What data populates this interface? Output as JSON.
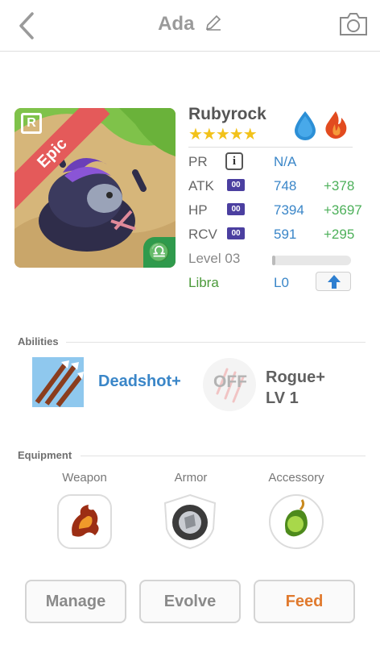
{
  "header": {
    "title": "Ada"
  },
  "card": {
    "rarity_badge": "R",
    "rarity": "Epic",
    "sign_glyph": "♎"
  },
  "monster": {
    "name": "Rubyrock",
    "stars": "★★★★★",
    "elements": [
      "water-drop-icon",
      "fire-icon"
    ],
    "colors": {
      "water": "#2c8fd6",
      "fire": "#e24b1f",
      "star": "#f2c21a"
    }
  },
  "stats": {
    "pr": {
      "label": "PR",
      "value": "N/A"
    },
    "atk": {
      "label": "ATK",
      "badge": "00",
      "value": "748",
      "bonus": "+378"
    },
    "hp": {
      "label": "HP",
      "badge": "00",
      "value": "7394",
      "bonus": "+3697"
    },
    "rcv": {
      "label": "RCV",
      "badge": "00",
      "value": "591",
      "bonus": "+295"
    },
    "level": {
      "label": "Level 03",
      "progress": 0.04
    },
    "sign": {
      "label": "Libra",
      "value": "L0"
    }
  },
  "abilities": {
    "title": "Abilities",
    "primary": {
      "name": "Deadshot+"
    },
    "secondary": {
      "state": "OFF",
      "name": "Rogue+",
      "level": "LV 1"
    }
  },
  "equipment": {
    "title": "Equipment",
    "slots": [
      {
        "label": "Weapon"
      },
      {
        "label": "Armor"
      },
      {
        "label": "Accessory"
      }
    ]
  },
  "buttons": {
    "manage": "Manage",
    "evolve": "Evolve",
    "feed": "Feed"
  }
}
